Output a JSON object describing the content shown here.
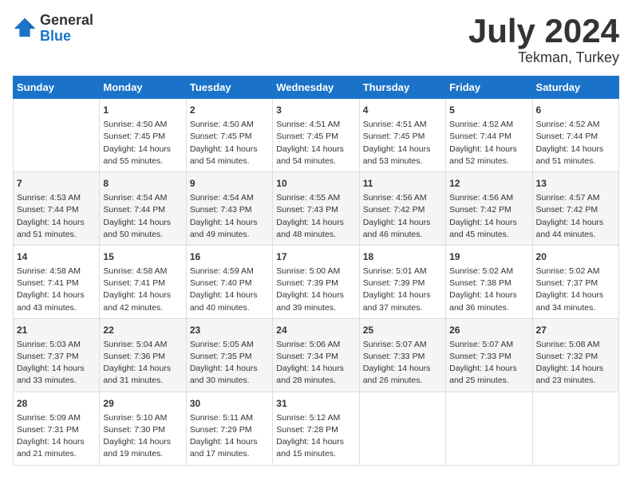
{
  "logo": {
    "general": "General",
    "blue": "Blue"
  },
  "title": "July 2024",
  "location": "Tekman, Turkey",
  "columns": [
    "Sunday",
    "Monday",
    "Tuesday",
    "Wednesday",
    "Thursday",
    "Friday",
    "Saturday"
  ],
  "rows": [
    [
      {
        "day": "",
        "info": ""
      },
      {
        "day": "1",
        "info": "Sunrise: 4:50 AM\nSunset: 7:45 PM\nDaylight: 14 hours\nand 55 minutes."
      },
      {
        "day": "2",
        "info": "Sunrise: 4:50 AM\nSunset: 7:45 PM\nDaylight: 14 hours\nand 54 minutes."
      },
      {
        "day": "3",
        "info": "Sunrise: 4:51 AM\nSunset: 7:45 PM\nDaylight: 14 hours\nand 54 minutes."
      },
      {
        "day": "4",
        "info": "Sunrise: 4:51 AM\nSunset: 7:45 PM\nDaylight: 14 hours\nand 53 minutes."
      },
      {
        "day": "5",
        "info": "Sunrise: 4:52 AM\nSunset: 7:44 PM\nDaylight: 14 hours\nand 52 minutes."
      },
      {
        "day": "6",
        "info": "Sunrise: 4:52 AM\nSunset: 7:44 PM\nDaylight: 14 hours\nand 51 minutes."
      }
    ],
    [
      {
        "day": "7",
        "info": "Sunrise: 4:53 AM\nSunset: 7:44 PM\nDaylight: 14 hours\nand 51 minutes."
      },
      {
        "day": "8",
        "info": "Sunrise: 4:54 AM\nSunset: 7:44 PM\nDaylight: 14 hours\nand 50 minutes."
      },
      {
        "day": "9",
        "info": "Sunrise: 4:54 AM\nSunset: 7:43 PM\nDaylight: 14 hours\nand 49 minutes."
      },
      {
        "day": "10",
        "info": "Sunrise: 4:55 AM\nSunset: 7:43 PM\nDaylight: 14 hours\nand 48 minutes."
      },
      {
        "day": "11",
        "info": "Sunrise: 4:56 AM\nSunset: 7:42 PM\nDaylight: 14 hours\nand 46 minutes."
      },
      {
        "day": "12",
        "info": "Sunrise: 4:56 AM\nSunset: 7:42 PM\nDaylight: 14 hours\nand 45 minutes."
      },
      {
        "day": "13",
        "info": "Sunrise: 4:57 AM\nSunset: 7:42 PM\nDaylight: 14 hours\nand 44 minutes."
      }
    ],
    [
      {
        "day": "14",
        "info": "Sunrise: 4:58 AM\nSunset: 7:41 PM\nDaylight: 14 hours\nand 43 minutes."
      },
      {
        "day": "15",
        "info": "Sunrise: 4:58 AM\nSunset: 7:41 PM\nDaylight: 14 hours\nand 42 minutes."
      },
      {
        "day": "16",
        "info": "Sunrise: 4:59 AM\nSunset: 7:40 PM\nDaylight: 14 hours\nand 40 minutes."
      },
      {
        "day": "17",
        "info": "Sunrise: 5:00 AM\nSunset: 7:39 PM\nDaylight: 14 hours\nand 39 minutes."
      },
      {
        "day": "18",
        "info": "Sunrise: 5:01 AM\nSunset: 7:39 PM\nDaylight: 14 hours\nand 37 minutes."
      },
      {
        "day": "19",
        "info": "Sunrise: 5:02 AM\nSunset: 7:38 PM\nDaylight: 14 hours\nand 36 minutes."
      },
      {
        "day": "20",
        "info": "Sunrise: 5:02 AM\nSunset: 7:37 PM\nDaylight: 14 hours\nand 34 minutes."
      }
    ],
    [
      {
        "day": "21",
        "info": "Sunrise: 5:03 AM\nSunset: 7:37 PM\nDaylight: 14 hours\nand 33 minutes."
      },
      {
        "day": "22",
        "info": "Sunrise: 5:04 AM\nSunset: 7:36 PM\nDaylight: 14 hours\nand 31 minutes."
      },
      {
        "day": "23",
        "info": "Sunrise: 5:05 AM\nSunset: 7:35 PM\nDaylight: 14 hours\nand 30 minutes."
      },
      {
        "day": "24",
        "info": "Sunrise: 5:06 AM\nSunset: 7:34 PM\nDaylight: 14 hours\nand 28 minutes."
      },
      {
        "day": "25",
        "info": "Sunrise: 5:07 AM\nSunset: 7:33 PM\nDaylight: 14 hours\nand 26 minutes."
      },
      {
        "day": "26",
        "info": "Sunrise: 5:07 AM\nSunset: 7:33 PM\nDaylight: 14 hours\nand 25 minutes."
      },
      {
        "day": "27",
        "info": "Sunrise: 5:08 AM\nSunset: 7:32 PM\nDaylight: 14 hours\nand 23 minutes."
      }
    ],
    [
      {
        "day": "28",
        "info": "Sunrise: 5:09 AM\nSunset: 7:31 PM\nDaylight: 14 hours\nand 21 minutes."
      },
      {
        "day": "29",
        "info": "Sunrise: 5:10 AM\nSunset: 7:30 PM\nDaylight: 14 hours\nand 19 minutes."
      },
      {
        "day": "30",
        "info": "Sunrise: 5:11 AM\nSunset: 7:29 PM\nDaylight: 14 hours\nand 17 minutes."
      },
      {
        "day": "31",
        "info": "Sunrise: 5:12 AM\nSunset: 7:28 PM\nDaylight: 14 hours\nand 15 minutes."
      },
      {
        "day": "",
        "info": ""
      },
      {
        "day": "",
        "info": ""
      },
      {
        "day": "",
        "info": ""
      }
    ]
  ]
}
